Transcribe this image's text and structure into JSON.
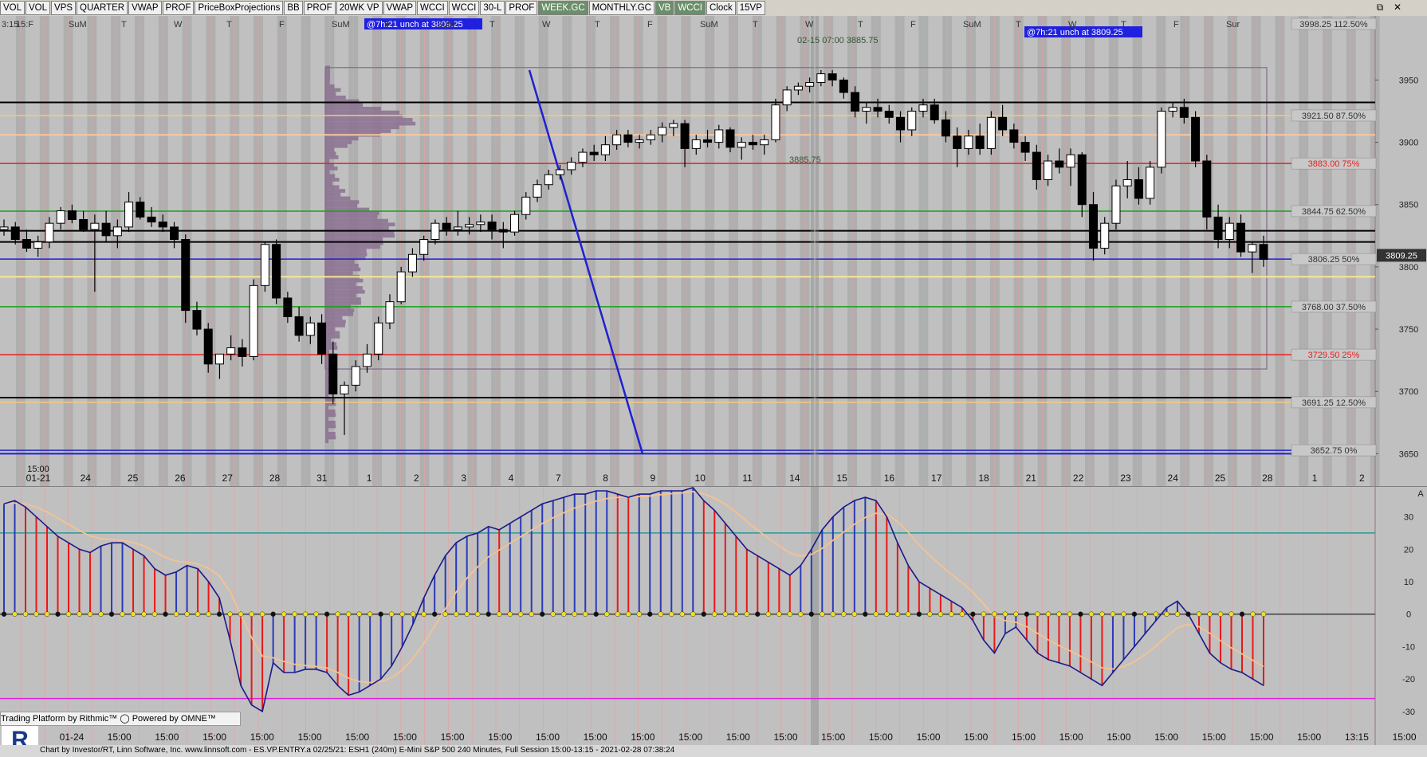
{
  "toolbar": {
    "buttons": [
      {
        "label": "VOL",
        "on": false
      },
      {
        "label": "VOL",
        "on": false
      },
      {
        "label": "VPS",
        "on": false
      },
      {
        "label": "QUARTER",
        "on": false
      },
      {
        "label": "VWAP",
        "on": false
      },
      {
        "label": "PROF",
        "on": false
      },
      {
        "label": "PriceBoxProjections",
        "on": false
      },
      {
        "label": "BB",
        "on": false
      },
      {
        "label": "PROF",
        "on": false
      },
      {
        "label": "20WK VP",
        "on": false
      },
      {
        "label": "VWAP",
        "on": false
      },
      {
        "label": "WCCI",
        "on": false
      },
      {
        "label": "WCCI",
        "on": false
      },
      {
        "label": "30-L",
        "on": false
      },
      {
        "label": "PROF",
        "on": false
      },
      {
        "label": "WEEK.GC",
        "on": true
      },
      {
        "label": "MONTHLY.GC",
        "on": false
      },
      {
        "label": "VB",
        "on": true
      },
      {
        "label": "WCCI",
        "on": true
      },
      {
        "label": "Clock",
        "on": false
      },
      {
        "label": "15VP",
        "on": false
      }
    ],
    "window_icons": [
      "restore-icon",
      "close-icon"
    ]
  },
  "chart_data": [
    {
      "type": "candlestick",
      "title": "ESH1 (240m) E-Mini S&P 500",
      "ylim": [
        3640,
        3998.25
      ],
      "y_ticks": [
        3650,
        3700,
        3750,
        3800,
        3850,
        3900,
        3950
      ],
      "y_tick_labels": [
        "3650",
        "3700",
        "3750",
        "3800",
        "3850",
        "3900",
        "3950"
      ],
      "current_price": "3809.25",
      "x_date_labels": [
        "01-21",
        "24",
        "25",
        "26",
        "27",
        "28",
        "31",
        "1",
        "2",
        "3",
        "4",
        "7",
        "8",
        "9",
        "10",
        "11",
        "14",
        "15",
        "16",
        "17",
        "18",
        "21",
        "22",
        "23",
        "24",
        "25",
        "28",
        "1",
        "2"
      ],
      "x_time_label": "15:00",
      "day_labels": [
        "15:F",
        "SuM",
        "T",
        "W",
        "T",
        "F",
        "SuM",
        "F",
        "SuM",
        "T",
        "W",
        "T",
        "F",
        "SuM",
        "T",
        "W",
        "T",
        "F",
        "SuM",
        "T",
        "W",
        "T",
        "F",
        "Sur"
      ],
      "corner_label": "3:15",
      "annotations": [
        {
          "text": "@7h:21  unch at 3809.25"
        },
        {
          "text": "@7h:21  unch at 3809.25"
        },
        {
          "text": "02-15 07:00  3885.75"
        },
        {
          "text": "3885.75"
        }
      ],
      "price_box": {
        "high": 3960,
        "low": 3718
      },
      "levels": [
        {
          "price": 3998.25,
          "label": "3998.25 112.50%",
          "color": "#c0c0c0",
          "label_color": "#333333"
        },
        {
          "price": 3921.5,
          "label": "3921.50 87.50%",
          "color": "#f5c97a",
          "label_color": "#333333"
        },
        {
          "price": 3883.0,
          "label": "3883.00 75%",
          "color": "#e82020",
          "label_color": "#e82020"
        },
        {
          "price": 3844.75,
          "label": "3844.75 62.50%",
          "color": "#18a018",
          "label_color": "#333333"
        },
        {
          "price": 3806.25,
          "label": "3806.25 50%",
          "color": "#2020d0",
          "label_color": "#333333"
        },
        {
          "price": 3768.0,
          "label": "3768.00 37.50%",
          "color": "#18a018",
          "label_color": "#333333"
        },
        {
          "price": 3729.5,
          "label": "3729.50 25%",
          "color": "#e82020",
          "label_color": "#e82020"
        },
        {
          "price": 3691.25,
          "label": "3691.25 12.50%",
          "color": "#f5c97a",
          "label_color": "#333333"
        },
        {
          "price": 3652.75,
          "label": "3652.75 0%",
          "color": "#2020d0",
          "label_color": "#333333"
        }
      ],
      "extra_lines": [
        {
          "price": 3932,
          "color": "#000000"
        },
        {
          "price": 3906,
          "color": "#f8c8a0"
        },
        {
          "price": 3829,
          "color": "#000000"
        },
        {
          "price": 3820,
          "color": "#000000"
        },
        {
          "price": 3792,
          "color": "#f8e890"
        },
        {
          "price": 3695,
          "color": "#000000"
        },
        {
          "price": 3650,
          "color": "#2020d0"
        }
      ],
      "candles": [
        [
          3830,
          3838,
          3825,
          3832
        ],
        [
          3832,
          3836,
          3818,
          3822
        ],
        [
          3822,
          3830,
          3812,
          3815
        ],
        [
          3815,
          3825,
          3808,
          3820
        ],
        [
          3820,
          3840,
          3815,
          3835
        ],
        [
          3835,
          3848,
          3830,
          3845
        ],
        [
          3845,
          3850,
          3835,
          3838
        ],
        [
          3838,
          3845,
          3828,
          3830
        ],
        [
          3830,
          3842,
          3780,
          3835
        ],
        [
          3835,
          3845,
          3820,
          3825
        ],
        [
          3825,
          3838,
          3815,
          3832
        ],
        [
          3832,
          3860,
          3828,
          3852
        ],
        [
          3852,
          3856,
          3838,
          3840
        ],
        [
          3840,
          3848,
          3832,
          3836
        ],
        [
          3836,
          3842,
          3828,
          3832
        ],
        [
          3832,
          3836,
          3815,
          3822
        ],
        [
          3822,
          3826,
          3755,
          3765
        ],
        [
          3765,
          3772,
          3745,
          3750
        ],
        [
          3750,
          3755,
          3715,
          3722
        ],
        [
          3722,
          3728,
          3710,
          3730
        ],
        [
          3730,
          3745,
          3725,
          3735
        ],
        [
          3735,
          3742,
          3720,
          3728
        ],
        [
          3728,
          3790,
          3725,
          3785
        ],
        [
          3785,
          3820,
          3780,
          3818
        ],
        [
          3818,
          3822,
          3770,
          3775
        ],
        [
          3775,
          3780,
          3755,
          3760
        ],
        [
          3760,
          3768,
          3740,
          3745
        ],
        [
          3745,
          3760,
          3738,
          3755
        ],
        [
          3755,
          3762,
          3722,
          3730
        ],
        [
          3730,
          3740,
          3690,
          3698
        ],
        [
          3698,
          3708,
          3665,
          3705
        ],
        [
          3705,
          3725,
          3700,
          3720
        ],
        [
          3720,
          3738,
          3715,
          3730
        ],
        [
          3730,
          3760,
          3725,
          3755
        ],
        [
          3755,
          3778,
          3750,
          3772
        ],
        [
          3772,
          3800,
          3770,
          3796
        ],
        [
          3796,
          3815,
          3792,
          3810
        ],
        [
          3810,
          3825,
          3805,
          3822
        ],
        [
          3822,
          3838,
          3818,
          3835
        ],
        [
          3835,
          3840,
          3825,
          3830
        ],
        [
          3830,
          3845,
          3825,
          3832
        ],
        [
          3832,
          3840,
          3826,
          3834
        ],
        [
          3834,
          3842,
          3828,
          3836
        ],
        [
          3836,
          3842,
          3822,
          3830
        ],
        [
          3830,
          3836,
          3815,
          3828
        ],
        [
          3828,
          3845,
          3825,
          3842
        ],
        [
          3842,
          3860,
          3838,
          3856
        ],
        [
          3856,
          3870,
          3852,
          3866
        ],
        [
          3866,
          3878,
          3862,
          3874
        ],
        [
          3874,
          3882,
          3870,
          3878
        ],
        [
          3878,
          3888,
          3874,
          3884
        ],
        [
          3884,
          3895,
          3880,
          3892
        ],
        [
          3892,
          3898,
          3885,
          3890
        ],
        [
          3890,
          3905,
          3885,
          3898
        ],
        [
          3898,
          3910,
          3894,
          3906
        ],
        [
          3906,
          3910,
          3896,
          3900
        ],
        [
          3900,
          3906,
          3895,
          3902
        ],
        [
          3902,
          3910,
          3898,
          3906
        ],
        [
          3906,
          3916,
          3900,
          3912
        ],
        [
          3912,
          3918,
          3905,
          3915
        ],
        [
          3915,
          3918,
          3880,
          3895
        ],
        [
          3895,
          3906,
          3890,
          3902
        ],
        [
          3902,
          3910,
          3896,
          3900
        ],
        [
          3900,
          3914,
          3895,
          3910
        ],
        [
          3910,
          3912,
          3892,
          3896
        ],
        [
          3896,
          3904,
          3886,
          3900
        ],
        [
          3900,
          3906,
          3894,
          3898
        ],
        [
          3898,
          3906,
          3890,
          3902
        ],
        [
          3902,
          3935,
          3900,
          3930
        ],
        [
          3930,
          3945,
          3925,
          3942
        ],
        [
          3942,
          3948,
          3938,
          3945
        ],
        [
          3945,
          3952,
          3940,
          3948
        ],
        [
          3948,
          3958,
          3945,
          3955
        ],
        [
          3955,
          3958,
          3945,
          3950
        ],
        [
          3950,
          3952,
          3935,
          3940
        ],
        [
          3940,
          3945,
          3920,
          3925
        ],
        [
          3925,
          3932,
          3915,
          3928
        ],
        [
          3928,
          3935,
          3920,
          3925
        ],
        [
          3925,
          3930,
          3915,
          3920
        ],
        [
          3920,
          3925,
          3900,
          3910
        ],
        [
          3910,
          3928,
          3905,
          3925
        ],
        [
          3925,
          3935,
          3920,
          3930
        ],
        [
          3930,
          3935,
          3915,
          3918
        ],
        [
          3918,
          3925,
          3900,
          3905
        ],
        [
          3905,
          3912,
          3880,
          3895
        ],
        [
          3895,
          3910,
          3890,
          3905
        ],
        [
          3905,
          3915,
          3890,
          3895
        ],
        [
          3895,
          3925,
          3890,
          3920
        ],
        [
          3920,
          3930,
          3905,
          3910
        ],
        [
          3910,
          3915,
          3895,
          3900
        ],
        [
          3900,
          3905,
          3885,
          3892
        ],
        [
          3892,
          3898,
          3862,
          3870
        ],
        [
          3870,
          3890,
          3865,
          3885
        ],
        [
          3885,
          3895,
          3875,
          3880
        ],
        [
          3880,
          3895,
          3865,
          3890
        ],
        [
          3890,
          3892,
          3840,
          3850
        ],
        [
          3850,
          3860,
          3805,
          3815
        ],
        [
          3815,
          3840,
          3810,
          3835
        ],
        [
          3835,
          3870,
          3830,
          3865
        ],
        [
          3865,
          3885,
          3855,
          3870
        ],
        [
          3870,
          3880,
          3850,
          3855
        ],
        [
          3855,
          3885,
          3850,
          3880
        ],
        [
          3880,
          3928,
          3875,
          3925
        ],
        [
          3925,
          3932,
          3920,
          3928
        ],
        [
          3928,
          3935,
          3915,
          3920
        ],
        [
          3920,
          3925,
          3880,
          3885
        ],
        [
          3885,
          3890,
          3830,
          3840
        ],
        [
          3840,
          3850,
          3815,
          3822
        ],
        [
          3822,
          3840,
          3815,
          3835
        ],
        [
          3835,
          3842,
          3808,
          3812
        ],
        [
          3812,
          3820,
          3795,
          3818
        ],
        [
          3818,
          3825,
          3800,
          3806
        ]
      ]
    },
    {
      "type": "bar",
      "title": "WCCI",
      "ylim": [
        -32,
        38
      ],
      "y_ticks": [
        -30,
        -20,
        -10,
        0,
        10,
        20,
        30
      ],
      "y_tick_labels": [
        "-30",
        "-20",
        "-10",
        "0",
        "10",
        "20",
        "30"
      ],
      "corner_label": "A",
      "reference_lines": [
        {
          "value": 25,
          "color": "#2a9a9a"
        },
        {
          "value": 0,
          "color": "#404040"
        },
        {
          "value": -26,
          "color": "#e020e0"
        }
      ],
      "x_labels": [
        "01-24",
        "15:00",
        "15:00",
        "15:00",
        "15:00",
        "15:00",
        "15:00",
        "15:00",
        "15:00",
        "15:00",
        "15:00",
        "15:00",
        "15:00",
        "15:00",
        "15:00",
        "15:00",
        "15:00",
        "15:00",
        "15:00",
        "15:00",
        "15:00",
        "15:00",
        "15:00",
        "15:00",
        "15:00",
        "15:00",
        "15:00",
        "13:15",
        "15:00",
        "15:00"
      ],
      "values": [
        34,
        35,
        33,
        30,
        27,
        24,
        22,
        20,
        19,
        21,
        22,
        22,
        20,
        18,
        14,
        12,
        13,
        15,
        14,
        10,
        5,
        -8,
        -22,
        -28,
        -30,
        -15,
        -18,
        -18,
        -17,
        -17,
        -18,
        -22,
        -25,
        -24,
        -22,
        -20,
        -16,
        -10,
        -3,
        5,
        12,
        18,
        22,
        24,
        25,
        27,
        26,
        28,
        30,
        32,
        34,
        35,
        36,
        37,
        37,
        38,
        38,
        37,
        36,
        37,
        37,
        38,
        38,
        38,
        39,
        35,
        32,
        28,
        24,
        20,
        18,
        16,
        14,
        12,
        15,
        20,
        26,
        30,
        33,
        35,
        36,
        35,
        30,
        22,
        15,
        10,
        8,
        6,
        4,
        2,
        -2,
        -8,
        -12,
        -6,
        -4,
        -8,
        -12,
        -14,
        -15,
        -16,
        -18,
        -20,
        -22,
        -18,
        -14,
        -10,
        -6,
        -2,
        2,
        4,
        0,
        -6,
        -12,
        -15,
        -17,
        -18,
        -20,
        -22
      ],
      "colors_up_down": [
        "#2a3ab8",
        "#e81818"
      ]
    }
  ],
  "footer": {
    "rithmic_text": "Trading Platform by Rithmic™  ◯ Powered by OMNE™",
    "status_text": "Chart by Investor/RT, Linn Software, Inc. www.linnsoft.com - ES.VP.ENTRY.a     02/25/21: ESH1 (240m) E-Mini S&P 500 240 Minutes, Full Session 15:00-13:15 - 2021-02-28 07:38:24",
    "logo_letter": "R"
  }
}
